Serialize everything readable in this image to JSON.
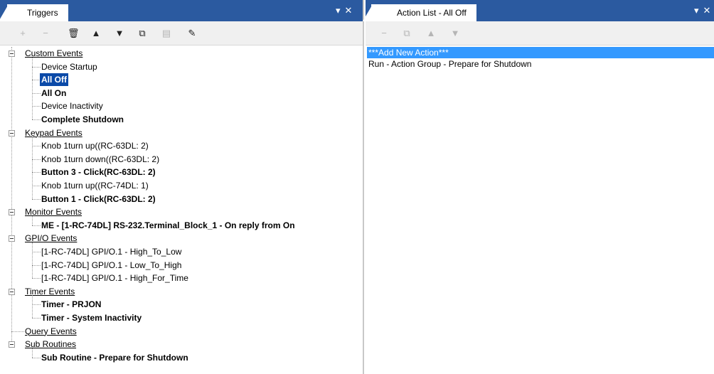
{
  "left_panel": {
    "tab_label": "Triggers",
    "pane_controls": [
      "▾",
      "✕"
    ],
    "toolbar": [
      {
        "icon": "add-icon",
        "glyph": "+",
        "enabled": false
      },
      {
        "icon": "remove-icon",
        "glyph": "−",
        "enabled": false
      },
      {
        "icon": "delete-icon",
        "glyph": "🗑",
        "enabled": true
      },
      {
        "icon": "move-up-icon",
        "glyph": "▲",
        "enabled": true
      },
      {
        "icon": "move-down-icon",
        "glyph": "▼",
        "enabled": true
      },
      {
        "icon": "copy-icon",
        "glyph": "⧉",
        "enabled": true
      },
      {
        "icon": "paste-icon",
        "glyph": "▤",
        "enabled": false
      },
      {
        "icon": "edit-icon",
        "glyph": "✎",
        "enabled": true
      }
    ],
    "tree": [
      {
        "label": "Custom Events",
        "children": [
          {
            "label": "Device Startup",
            "bold": false,
            "selected": false
          },
          {
            "label": "All Off",
            "bold": true,
            "selected": true
          },
          {
            "label": "All On",
            "bold": true,
            "selected": false
          },
          {
            "label": "Device Inactivity",
            "bold": false,
            "selected": false
          },
          {
            "label": "Complete Shutdown",
            "bold": true,
            "selected": false
          }
        ]
      },
      {
        "label": "Keypad Events",
        "children": [
          {
            "label": "Knob 1turn up((RC-63DL: 2)",
            "bold": false,
            "selected": false
          },
          {
            "label": "Knob 1turn down((RC-63DL: 2)",
            "bold": false,
            "selected": false
          },
          {
            "label": "Button 3 - Click(RC-63DL: 2)",
            "bold": true,
            "selected": false
          },
          {
            "label": "Knob 1turn up((RC-74DL: 1)",
            "bold": false,
            "selected": false
          },
          {
            "label": "Button 1 - Click(RC-63DL: 2)",
            "bold": true,
            "selected": false
          }
        ]
      },
      {
        "label": "Monitor Events",
        "children": [
          {
            "label": "ME - [1-RC-74DL] RS-232.Terminal_Block_1 - On reply from On",
            "bold": true,
            "selected": false
          }
        ]
      },
      {
        "label": "GPI/O Events",
        "children": [
          {
            "label": "[1-RC-74DL] GPI/O.1 - High_To_Low",
            "bold": false,
            "selected": false
          },
          {
            "label": "[1-RC-74DL] GPI/O.1 - Low_To_High",
            "bold": false,
            "selected": false
          },
          {
            "label": "[1-RC-74DL] GPI/O.1 - High_For_Time",
            "bold": false,
            "selected": false
          }
        ]
      },
      {
        "label": "Timer Events",
        "children": [
          {
            "label": "Timer - PRJON",
            "bold": true,
            "selected": false
          },
          {
            "label": "Timer - System Inactivity",
            "bold": true,
            "selected": false
          }
        ]
      },
      {
        "label": "Query Events",
        "children": []
      },
      {
        "label": "Sub Routines",
        "children": [
          {
            "label": "Sub Routine - Prepare for Shutdown",
            "bold": true,
            "selected": false
          }
        ]
      }
    ]
  },
  "right_panel": {
    "tab_label": "Action List - All Off",
    "pane_controls": [
      "▾",
      "✕"
    ],
    "toolbar": [
      {
        "icon": "remove-icon",
        "glyph": "−",
        "enabled": false
      },
      {
        "icon": "copy-icon",
        "glyph": "⧉",
        "enabled": false
      },
      {
        "icon": "move-up-icon",
        "glyph": "▲",
        "enabled": false
      },
      {
        "icon": "move-down-icon",
        "glyph": "▼",
        "enabled": false
      }
    ],
    "actions": [
      {
        "label": "***Add New Action***",
        "active": true
      },
      {
        "label": "Run - Action Group - Prepare for Shutdown",
        "active": false
      }
    ]
  },
  "colors": {
    "tab_bar": "#2b5aa0",
    "selection": "#0b4aa8",
    "list_highlight": "#3399ff",
    "toolbar_bg": "#f0f0f0"
  }
}
